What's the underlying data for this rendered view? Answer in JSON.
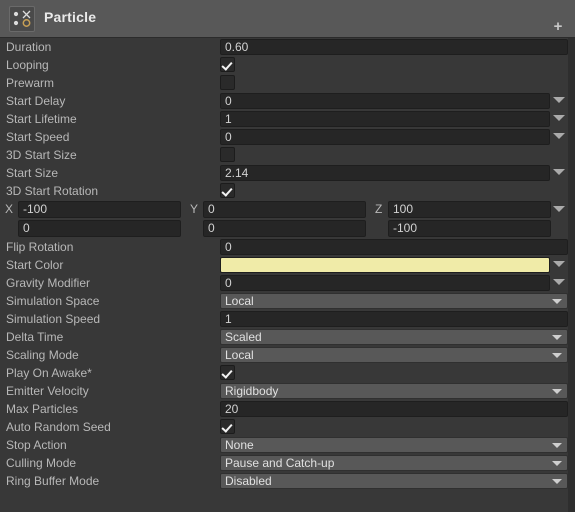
{
  "window": {
    "title": "Particle",
    "icon": "particle-system-icon",
    "add_component_icon": "plus-icon",
    "header_bg": "#585858",
    "body_bg": "#383838"
  },
  "colors": {
    "start_color_swatch": "#f0eba8",
    "input_bg": "#262626",
    "popup_bg": "#585858",
    "label_text": "#b8b8b8",
    "value_text": "#d2d2d2"
  },
  "properties": [
    {
      "label": "Duration",
      "type": "input",
      "value": "0.60",
      "arrow": false
    },
    {
      "label": "Looping",
      "type": "checkbox",
      "checked": true
    },
    {
      "label": "Prewarm",
      "type": "checkbox",
      "checked": false
    },
    {
      "label": "Start Delay",
      "type": "input",
      "value": "0",
      "arrow": true
    },
    {
      "label": "Start Lifetime",
      "type": "input",
      "value": "1",
      "arrow": true
    },
    {
      "label": "Start Speed",
      "type": "input",
      "value": "0",
      "arrow": true
    },
    {
      "label": "3D Start Size",
      "type": "checkbox",
      "checked": false
    },
    {
      "label": "Start Size",
      "type": "input",
      "value": "2.14",
      "arrow": true
    },
    {
      "label": "3D Start Rotation",
      "type": "checkbox",
      "checked": true
    },
    {
      "label": "Flip Rotation",
      "type": "input",
      "value": "0",
      "arrow": false
    },
    {
      "label": "Start Color",
      "type": "color",
      "value": "#f0eba8",
      "arrow": true
    },
    {
      "label": "Gravity Modifier",
      "type": "input",
      "value": "0",
      "arrow": true
    },
    {
      "label": "Simulation Space",
      "type": "popup",
      "value": "Local"
    },
    {
      "label": "Simulation Speed",
      "type": "input",
      "value": "1",
      "arrow": false
    },
    {
      "label": "Delta Time",
      "type": "popup",
      "value": "Scaled"
    },
    {
      "label": "Scaling Mode",
      "type": "popup",
      "value": "Local"
    },
    {
      "label": "Play On Awake*",
      "type": "checkbox",
      "checked": true
    },
    {
      "label": "Emitter Velocity",
      "type": "popup",
      "value": "Rigidbody"
    },
    {
      "label": "Max Particles",
      "type": "input",
      "value": "20",
      "arrow": false
    },
    {
      "label": "Auto Random Seed",
      "type": "checkbox",
      "checked": true
    },
    {
      "label": "Stop Action",
      "type": "popup",
      "value": "None"
    },
    {
      "label": "Culling Mode",
      "type": "popup",
      "value": "Pause and Catch-up"
    },
    {
      "label": "Ring Buffer Mode",
      "type": "popup",
      "value": "Disabled"
    }
  ],
  "rotation_vector": {
    "after_property_index": 8,
    "arrow": true,
    "axes": [
      {
        "axis": "X",
        "min": "-100",
        "max": "0"
      },
      {
        "axis": "Y",
        "min": "0",
        "max": "0"
      },
      {
        "axis": "Z",
        "min": "100",
        "max": "-100"
      }
    ]
  }
}
